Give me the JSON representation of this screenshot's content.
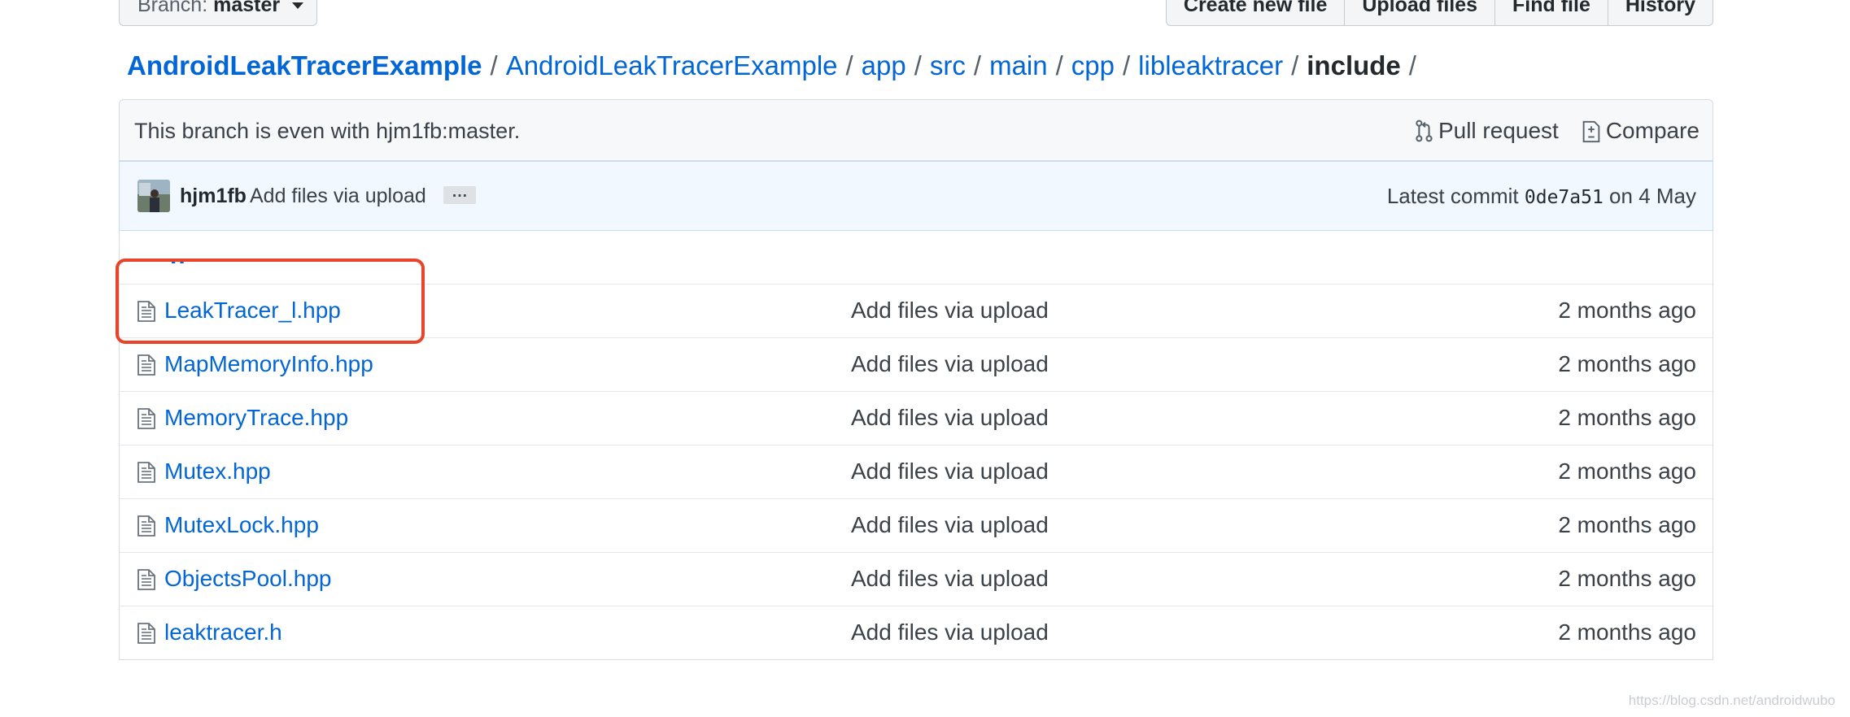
{
  "toolbar": {
    "branch_label": "Branch:",
    "branch_value": "master",
    "buttons": [
      "Create new file",
      "Upload files",
      "Find file",
      "History"
    ]
  },
  "breadcrumb": {
    "repo": "AndroidLeakTracerExample",
    "parts": [
      "AndroidLeakTracerExample",
      "app",
      "src",
      "main",
      "cpp",
      "libleaktracer"
    ],
    "current": "include",
    "separator": "/"
  },
  "compare": {
    "message": "This branch is even with hjm1fb:master.",
    "pull_request_label": "Pull request",
    "compare_label": "Compare"
  },
  "commit": {
    "author": "hjm1fb",
    "message": "Add files via upload",
    "ellipsis": "…",
    "latest_prefix": "Latest commit",
    "sha": "0de7a51",
    "date_text": "on 4 May"
  },
  "parent_dir": "..",
  "files": [
    {
      "name": "LeakTracer_l.hpp",
      "message": "Add files via upload",
      "age": "2 months ago"
    },
    {
      "name": "MapMemoryInfo.hpp",
      "message": "Add files via upload",
      "age": "2 months ago"
    },
    {
      "name": "MemoryTrace.hpp",
      "message": "Add files via upload",
      "age": "2 months ago"
    },
    {
      "name": "Mutex.hpp",
      "message": "Add files via upload",
      "age": "2 months ago"
    },
    {
      "name": "MutexLock.hpp",
      "message": "Add files via upload",
      "age": "2 months ago"
    },
    {
      "name": "ObjectsPool.hpp",
      "message": "Add files via upload",
      "age": "2 months ago"
    },
    {
      "name": "leaktracer.h",
      "message": "Add files via upload",
      "age": "2 months ago"
    }
  ],
  "watermark": "https://blog.csdn.net/androidwubo",
  "colors": {
    "link": "#0366d6",
    "highlight": "#e8442a",
    "commit_bg": "#f1f8ff"
  },
  "icons": {
    "file": "file-icon",
    "pull_request": "pull-request-icon",
    "compare": "compare-icon"
  }
}
